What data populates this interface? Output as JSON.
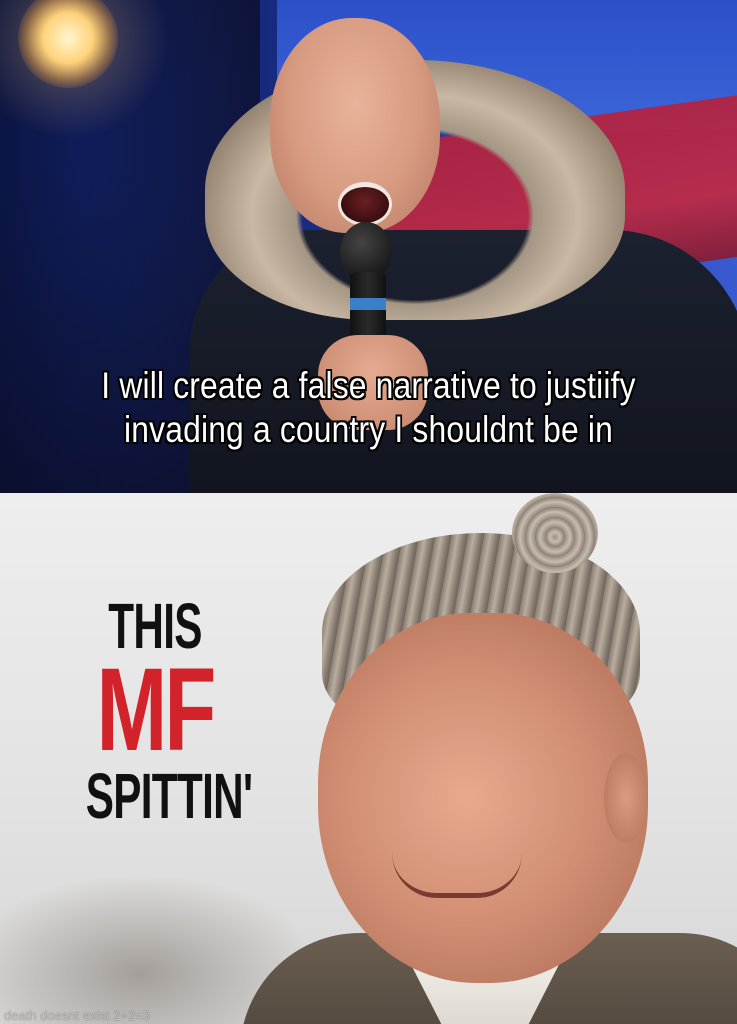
{
  "top_panel": {
    "caption_line_1": "I will create a false narrative to justiify",
    "caption_line_2": "invading a country I shouldnt be in",
    "caption_color": "#ffffff"
  },
  "bottom_panel": {
    "text_this": "THIS",
    "text_mf": "MF",
    "text_spittin": "SPITTIN'",
    "mf_color": "#d2232a",
    "text_color": "#111111"
  },
  "watermark": "death doesnt exist 2+2=3"
}
